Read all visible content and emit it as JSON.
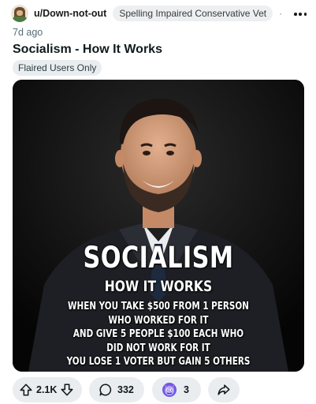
{
  "post": {
    "username": "u/Down-not-out",
    "user_flair": "Spelling Impaired Conservative Vet",
    "separator": "·",
    "time_ago": "7d ago",
    "title": "Socialism - How It Works",
    "post_flair": "Flaired Users Only"
  },
  "meme": {
    "headline": "SOCIALISM",
    "subheadline": "HOW IT WORKS",
    "body_lines": [
      "WHEN YOU TAKE $500 FROM 1 PERSON",
      "WHO WORKED FOR IT",
      "AND GIVE 5 PEOPLE $100 EACH WHO",
      "DID NOT WORK FOR IT",
      "YOU LOSE 1 VOTER BUT GAIN 5 OTHERS"
    ]
  },
  "actions": {
    "vote_count": "2.1K",
    "comment_count": "332",
    "award_count": "3",
    "icons": {
      "upvote": "arrow-up-icon",
      "downvote": "arrow-down-icon",
      "comments": "comment-bubble-icon",
      "awards": "award-icon",
      "share": "share-icon",
      "more": "more-dots-icon"
    }
  },
  "colors": {
    "pill_background": "#eaedef",
    "text_primary": "#1a1a1b",
    "text_secondary": "#576f76",
    "meme_background": "#0d0d0d"
  }
}
